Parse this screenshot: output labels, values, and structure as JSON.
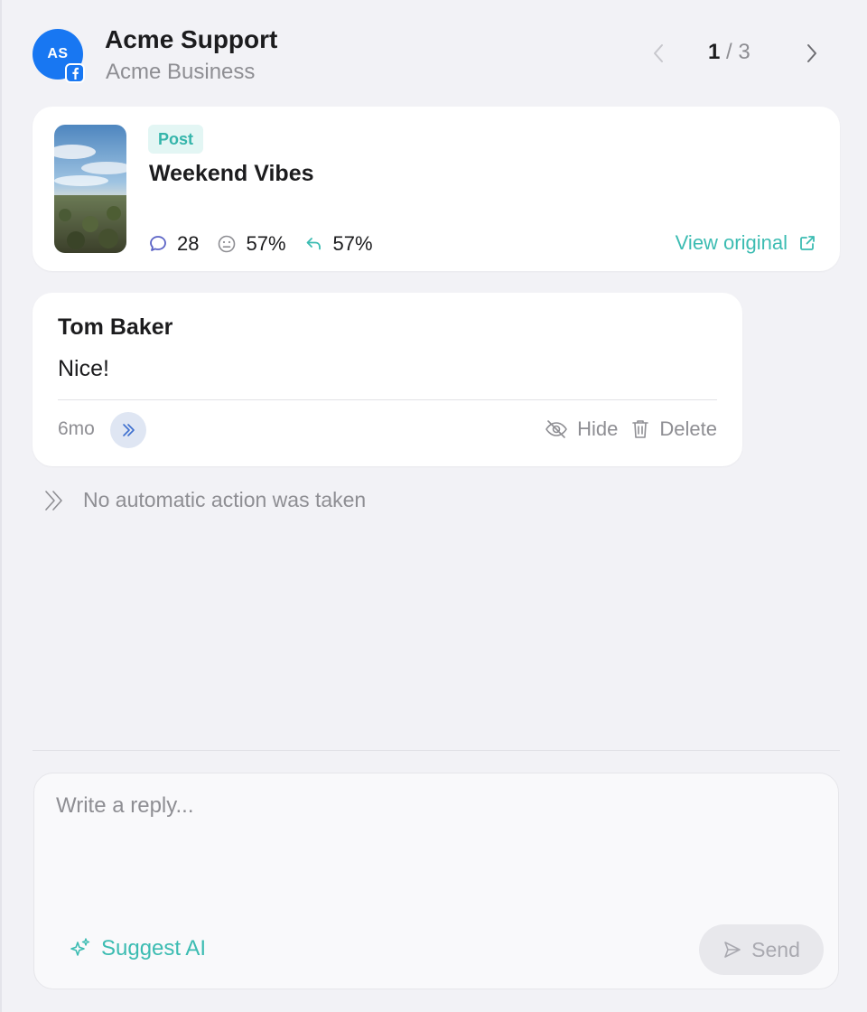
{
  "header": {
    "avatar_initials": "AS",
    "title": "Acme Support",
    "subtitle": "Acme Business",
    "pager": {
      "current": "1",
      "separator": "/",
      "total": "3"
    }
  },
  "post": {
    "badge": "Post",
    "title": "Weekend Vibes",
    "stats": {
      "comments": "28",
      "sentiment": "57%",
      "reply_rate": "57%"
    },
    "view_original": "View original"
  },
  "comment": {
    "author": "Tom Baker",
    "text": "Nice!",
    "time": "6mo",
    "actions": {
      "hide": "Hide",
      "delete": "Delete"
    }
  },
  "automation_note": "No automatic action was taken",
  "composer": {
    "placeholder": "Write a reply...",
    "value": "",
    "suggest_label": "Suggest AI",
    "send_label": "Send"
  },
  "colors": {
    "accent": "#3cbcb2",
    "facebook": "#1877f2",
    "muted": "#8e8e93",
    "background": "#f2f2f6"
  },
  "icons": [
    "facebook-icon",
    "chevron-left-icon",
    "chevron-right-icon",
    "comment-icon",
    "smiley-icon",
    "reply-icon",
    "external-link-icon",
    "double-chevron-icon",
    "eye-off-icon",
    "trash-icon",
    "sparkle-icon",
    "send-icon"
  ]
}
